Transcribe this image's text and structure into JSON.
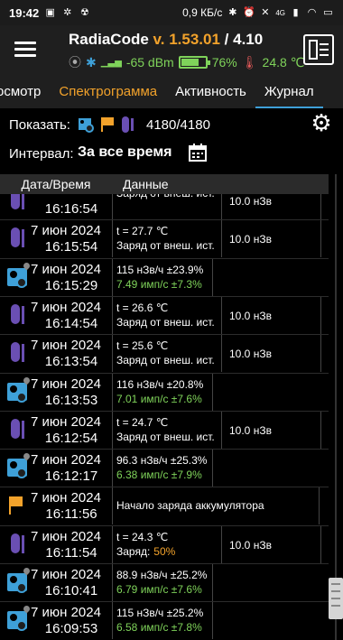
{
  "status_bar": {
    "time": "19:42",
    "net_speed": "0,9 КБ/с",
    "network": "4G"
  },
  "app": {
    "name": "RadiaCode",
    "version_prefix": "v.",
    "version": "1.53.01",
    "separator": "/",
    "device_version": "4.10",
    "signal": "-65 dBm",
    "battery": "76%",
    "battery_level": 0.76,
    "temperature": "24.8 ℃"
  },
  "tabs": [
    {
      "label": "осмотр"
    },
    {
      "label": "Спектрограмма"
    },
    {
      "label": "Активность"
    },
    {
      "label": "Журнал"
    }
  ],
  "filters": {
    "show_label": "Показать:",
    "count": "4180/4180",
    "interval_label": "Интервал:",
    "interval_value": "За все время"
  },
  "table": {
    "col_date": "Дата/Время",
    "col_data": "Данные"
  },
  "rows": [
    {
      "icon": "thermometer-icon",
      "date": "",
      "time": "16:16:54",
      "line1": "Заряд от внеш. ист.",
      "line2": "",
      "extra": "10.0 нЗв"
    },
    {
      "icon": "thermometer-icon",
      "date": "7 июн 2024",
      "time": "16:15:54",
      "line1": "t = 27.7 ℃",
      "line2": "Заряд от внеш. ист.",
      "extra": "10.0 нЗв"
    },
    {
      "icon": "dose-rate-icon",
      "date": "7 июн 2024",
      "time": "16:15:29",
      "line1": "115 нЗв/ч ±23.9%",
      "line2": "7.49 имп/с ±7.3%",
      "extra": ""
    },
    {
      "icon": "thermometer-icon",
      "date": "7 июн 2024",
      "time": "16:14:54",
      "line1": "t = 26.6 ℃",
      "line2": "Заряд от внеш. ист.",
      "extra": "10.0 нЗв"
    },
    {
      "icon": "thermometer-icon",
      "date": "7 июн 2024",
      "time": "16:13:54",
      "line1": "t = 25.6 ℃",
      "line2": "Заряд от внеш. ист.",
      "extra": "10.0 нЗв"
    },
    {
      "icon": "dose-rate-icon",
      "date": "7 июн 2024",
      "time": "16:13:53",
      "line1": "116 нЗв/ч ±20.8%",
      "line2": "7.01 имп/с ±7.6%",
      "extra": ""
    },
    {
      "icon": "thermometer-icon",
      "date": "7 июн 2024",
      "time": "16:12:54",
      "line1": "t = 24.7 ℃",
      "line2": "Заряд от внеш. ист.",
      "extra": "10.0 нЗв"
    },
    {
      "icon": "dose-rate-icon",
      "date": "7 июн 2024",
      "time": "16:12:17",
      "line1": "96.3 нЗв/ч ±25.3%",
      "line2": "6.38 имп/с ±7.9%",
      "extra": ""
    },
    {
      "icon": "flag-icon",
      "date": "7 июн 2024",
      "time": "16:11:56",
      "line1": "Начало заряда аккумулятора",
      "line2": "",
      "extra": ""
    },
    {
      "icon": "thermometer-icon",
      "date": "7 июн 2024",
      "time": "16:11:54",
      "line1": "t = 24.3 ℃",
      "line2": "Заряд:",
      "line2_value": "50%",
      "extra": "10.0 нЗв"
    },
    {
      "icon": "dose-rate-icon",
      "date": "7 июн 2024",
      "time": "16:10:41",
      "line1": "88.9 нЗв/ч ±25.2%",
      "line2": "6.79 имп/с ±7.6%",
      "extra": ""
    },
    {
      "icon": "dose-rate-icon",
      "date": "7 июн 2024",
      "time": "16:09:53",
      "line1": "115 нЗв/ч ±25.2%",
      "line2": "6.58 имп/с ±7.8%",
      "extra": ""
    }
  ]
}
